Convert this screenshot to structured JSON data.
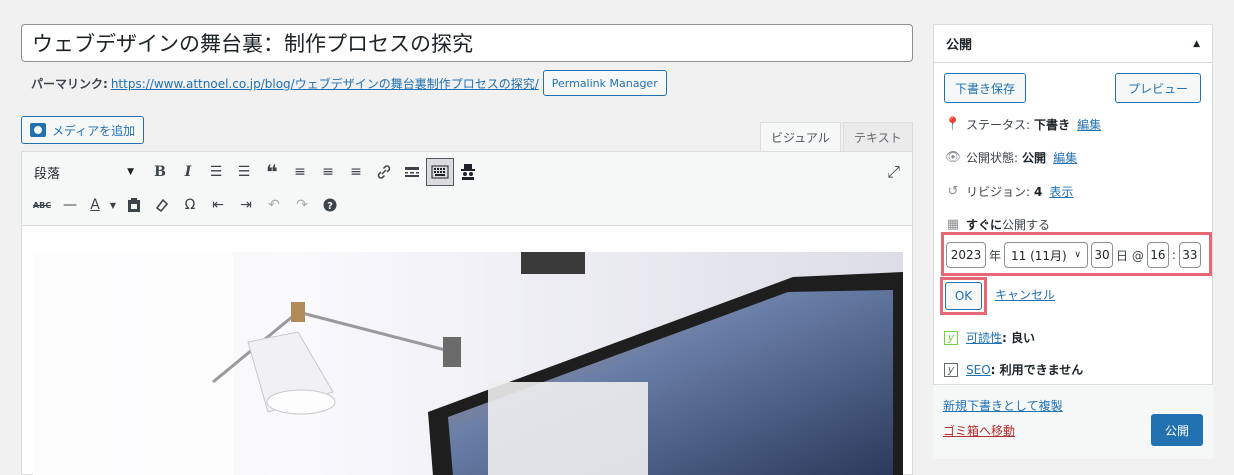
{
  "post": {
    "title": "ウェブデザインの舞台裏：制作プロセスの探究",
    "permalink_label": "パーマリンク:",
    "permalink_url": "https://www.attnoel.co.jp/blog/ウェブデザインの舞台裏制作プロセスの探究/",
    "permalink_manager_button": "Permalink Manager"
  },
  "editor": {
    "add_media_label": "メディアを追加",
    "tab_visual": "ビジュアル",
    "tab_text": "テキスト",
    "format_select": "段落",
    "icons_row1": [
      "bold-icon",
      "italic-icon",
      "bullet-list-icon",
      "numbered-list-icon",
      "blockquote-icon",
      "align-left-icon",
      "align-center-icon",
      "align-right-icon",
      "link-icon",
      "read-more-icon",
      "toolbar-toggle-icon",
      "incognito-icon"
    ],
    "icons_row2": [
      "strikethrough-icon",
      "horizontal-rule-icon",
      "text-color-icon",
      "paste-as-text-icon",
      "clear-formatting-icon",
      "special-character-icon",
      "outdent-icon",
      "indent-icon",
      "undo-icon",
      "redo-icon",
      "help-icon"
    ],
    "glyphs": {
      "bold": "B",
      "italic": "I",
      "bullets": "☰",
      "numbers": "☰",
      "quote": "❝",
      "align_left": "≡",
      "align_center": "≡",
      "align_right": "≡",
      "link": "🔗",
      "readmore": "▭",
      "keyboard": "⌨",
      "spy": "🕵",
      "abc": "ABC",
      "hr": "—",
      "color": "A",
      "paste": "📋",
      "eraser": "⌫",
      "omega": "Ω",
      "outdent": "⇤",
      "indent": "⇥",
      "undo": "↶",
      "redo": "↷",
      "help": "?",
      "expand": "⤢"
    }
  },
  "publish_box": {
    "heading": "公開",
    "save_draft": "下書き保存",
    "preview": "プレビュー",
    "status_label": "ステータス:",
    "status_value": "下書き",
    "status_edit": "編集",
    "visibility_label": "公開状態:",
    "visibility_value": "公開",
    "visibility_edit": "編集",
    "revisions_label": "リビジョン:",
    "revisions_value": "4",
    "revisions_link": "表示",
    "schedule_bold": "すぐに",
    "schedule_rest": "公開する",
    "date": {
      "year": "2023",
      "year_suffix": "年",
      "month": "11 (11月)",
      "day": "30",
      "day_suffix": "日 @",
      "hour": "16",
      "sep": ":",
      "minute": "33"
    },
    "ok": "OK",
    "cancel": "キャンセル",
    "readability_label": "可読性",
    "readability_value": ": 良い",
    "seo_label": "SEO",
    "seo_value": ": 利用できません",
    "duplicate_link": "新規下書きとして複製",
    "trash_link": "ゴミ箱へ移動",
    "publish_button": "公開"
  }
}
